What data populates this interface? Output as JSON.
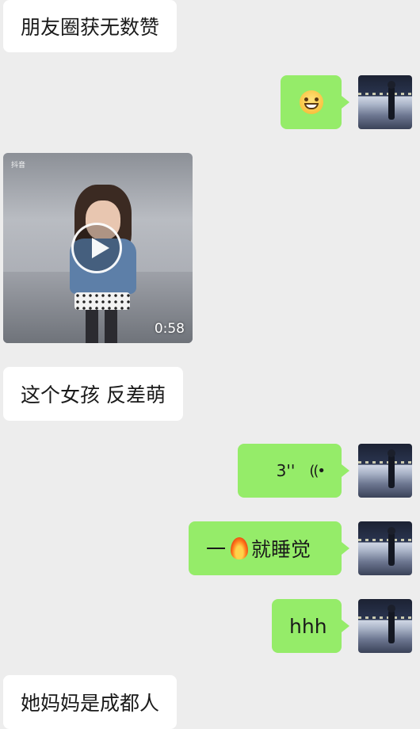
{
  "messages": {
    "m1": {
      "text": "朋友圈获无数赞"
    },
    "m2": {
      "emoji": "grinning-face"
    },
    "m3": {
      "duration": "0:58",
      "watermark": "抖音"
    },
    "m4": {
      "text": "这个女孩 反差萌"
    },
    "m5": {
      "duration": "3''",
      "icon": "voice-wave-icon"
    },
    "m6": {
      "before": "一",
      "emoji": "fire",
      "after": "就睡觉"
    },
    "m7": {
      "text": "hhh"
    },
    "m8": {
      "text": "她妈妈是成都人"
    }
  },
  "colors": {
    "background": "#ededed",
    "incoming_bubble": "#ffffff",
    "outgoing_bubble": "#95ec69"
  }
}
